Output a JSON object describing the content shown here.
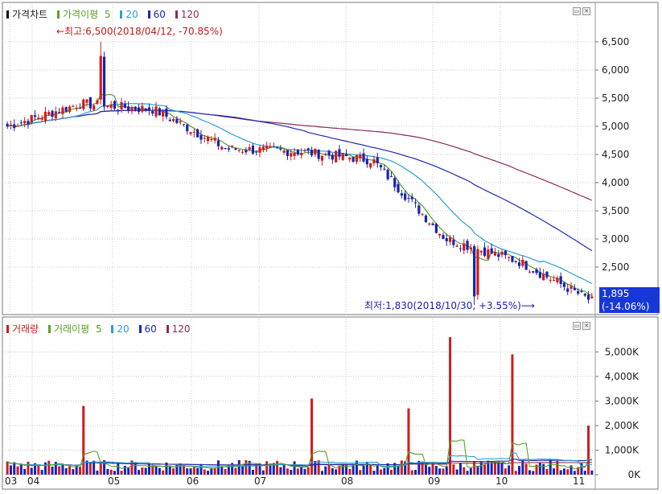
{
  "price_legend": {
    "series_title": "가격차트",
    "ma_label": "가격이평",
    "ma_periods": [
      "5",
      "20",
      "60",
      "120"
    ],
    "high_note": "←최고:6,500(2018/04/12, -70.85%)",
    "low_note": "최저:1,830(2018/10/30, +3.55%)⟶"
  },
  "volume_legend": {
    "series_title": "거래량",
    "ma_label": "거래이평",
    "ma_periods": [
      "5",
      "20",
      "60",
      "120"
    ]
  },
  "current_price": {
    "price": "1,895",
    "change": "(-14.06%)"
  },
  "colors": {
    "up": "#d01c1c",
    "down": "#1a22b0",
    "ma5": "#5aa028",
    "ma20": "#2a9fd6",
    "ma60": "#1b2ab4",
    "ma120": "#8a2a5e",
    "tag_bg": "#1737d6",
    "grid": "#c8c8c8"
  },
  "chart_data": [
    {
      "type": "candlestick",
      "title": "가격차트",
      "y_ticks": [
        "6,500",
        "6,000",
        "5,500",
        "5,000",
        "4,500",
        "4,000",
        "3,500",
        "3,000",
        "2,500"
      ],
      "y_tick_values": [
        6500,
        6000,
        5500,
        5000,
        4500,
        4000,
        3500,
        3000,
        2500
      ],
      "ylim": [
        1700,
        6900
      ],
      "x_ticks": [
        "03",
        "04",
        "05",
        "06",
        "07",
        "08",
        "09",
        "10",
        "11"
      ],
      "grid": true,
      "approx_close_path": [
        {
          "month": "03",
          "close": 5000
        },
        {
          "month": "04",
          "close": 5400
        },
        {
          "month": "05",
          "close": 5300
        },
        {
          "month": "06",
          "close": 4600
        },
        {
          "month": "07",
          "close": 4550
        },
        {
          "month": "08",
          "close": 4400
        },
        {
          "month": "09",
          "close": 3000
        },
        {
          "month": "10",
          "close": 2600
        },
        {
          "month": "11",
          "close": 1895
        }
      ],
      "high": 6500,
      "low": 1830
    },
    {
      "type": "bar",
      "title": "거래량",
      "y_ticks": [
        "5,000K",
        "4,000K",
        "3,000K",
        "2,000K",
        "1,000K",
        "0K"
      ],
      "y_tick_values": [
        5000,
        4000,
        3000,
        2000,
        1000,
        0
      ],
      "ylim": [
        0,
        5700
      ],
      "x_ticks": [
        "03",
        "04",
        "05",
        "06",
        "07",
        "08",
        "09",
        "10",
        "11"
      ],
      "grid": true,
      "volume_spikes_k": [
        {
          "month": "04",
          "value": 2800
        },
        {
          "month": "06",
          "value": 3100
        },
        {
          "month": "07",
          "value": 2700
        },
        {
          "month": "08",
          "value": 5600
        },
        {
          "month": "09",
          "value": 4900
        },
        {
          "month": "11",
          "value": 2000
        }
      ]
    }
  ]
}
